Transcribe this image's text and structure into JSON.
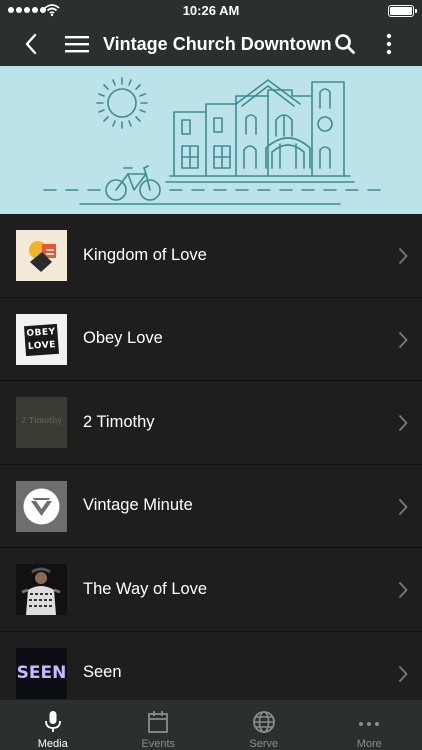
{
  "status_bar": {
    "time": "10:26 AM"
  },
  "nav": {
    "title": "Vintage Church Downtown"
  },
  "items": [
    {
      "label": "Kingdom of Love"
    },
    {
      "label": "Obey Love",
      "thumb_text_1": "OBEY",
      "thumb_text_2": "LOVE"
    },
    {
      "label": "2 Timothy",
      "thumb_text": "2 Timothy"
    },
    {
      "label": "Vintage Minute"
    },
    {
      "label": "The Way of Love"
    },
    {
      "label": "Seen",
      "thumb_text": "SEEN"
    }
  ],
  "tabs": [
    {
      "label": "Media",
      "icon": "microphone-icon",
      "active": true
    },
    {
      "label": "Events",
      "icon": "calendar-icon",
      "active": false
    },
    {
      "label": "Serve",
      "icon": "globe-icon",
      "active": false
    },
    {
      "label": "More",
      "icon": "ellipsis-icon",
      "active": false
    }
  ],
  "colors": {
    "nav_bg": "#2b2f2f",
    "banner_bg": "#bde3ea",
    "banner_line": "#3c8c94",
    "list_bg": "#1e1e1e",
    "tab_inactive": "#8a8d8d"
  }
}
